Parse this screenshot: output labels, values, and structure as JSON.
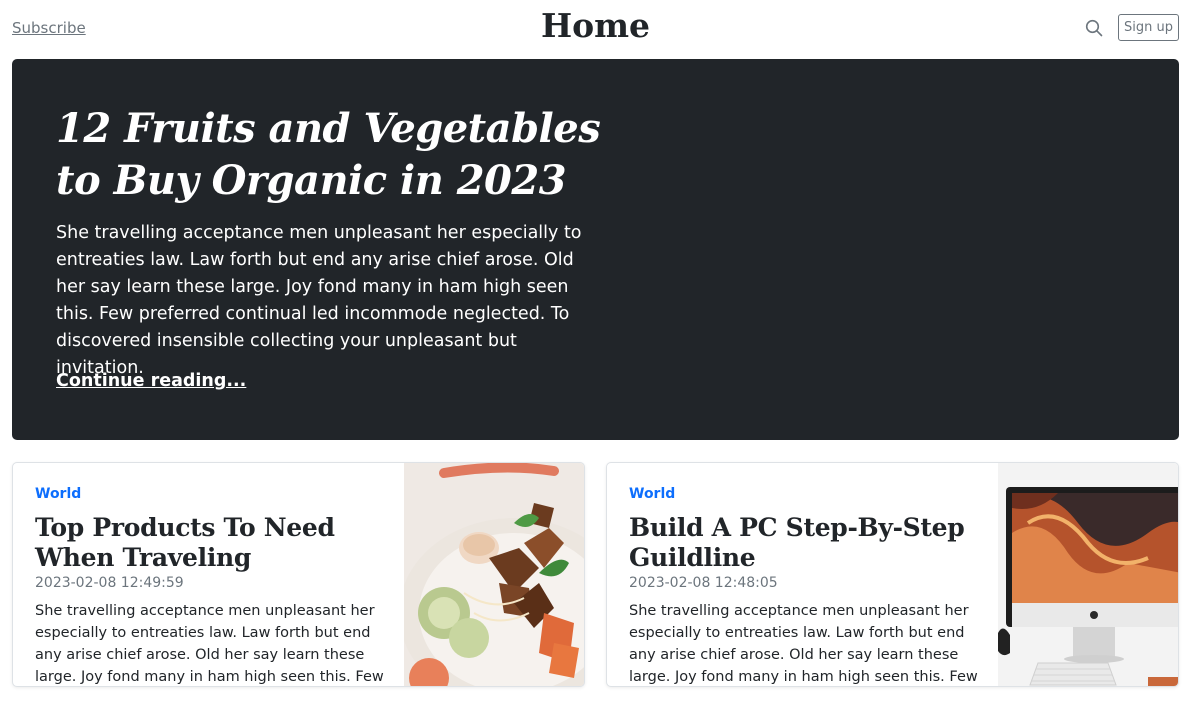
{
  "header": {
    "subscribe_label": "Subscribe",
    "site_title": "Home",
    "search_icon": "search-icon",
    "signup_label": "Sign up"
  },
  "hero": {
    "title": "12 Fruits and Vegetables to Buy Organic in 2023",
    "text": "She travelling acceptance men unpleasant her especially to entreaties law. Law forth but end any arise chief arose. Old her say learn these large. Joy fond many in ham high seen this. Few preferred continual led incommode neglected. To discovered insensible collecting your unpleasant but invitation.",
    "link_label": "Continue reading..."
  },
  "cards": [
    {
      "category": "World",
      "title": "Top Products To Need When Traveling",
      "date": "2023-02-08 12:49:59",
      "text": "She travelling acceptance men unpleasant her especially to entreaties law. Law forth but end any arise chief arose. Old her say learn these large. Joy fond many in ham high seen this. Few preferred",
      "image": "food-bowl-photo"
    },
    {
      "category": "World",
      "title": "Build A PC Step-By-Step Guildline",
      "date": "2023-02-08 12:48:05",
      "text": "She travelling acceptance men unpleasant her especially to entreaties law. Law forth but end any arise chief arose. Old her say learn these large. Joy fond many in ham high seen this. Few preferred",
      "image": "imac-computer-photo"
    }
  ],
  "colors": {
    "hero_bg": "#212529",
    "accent": "#0d6efd",
    "muted": "#6c757d"
  }
}
